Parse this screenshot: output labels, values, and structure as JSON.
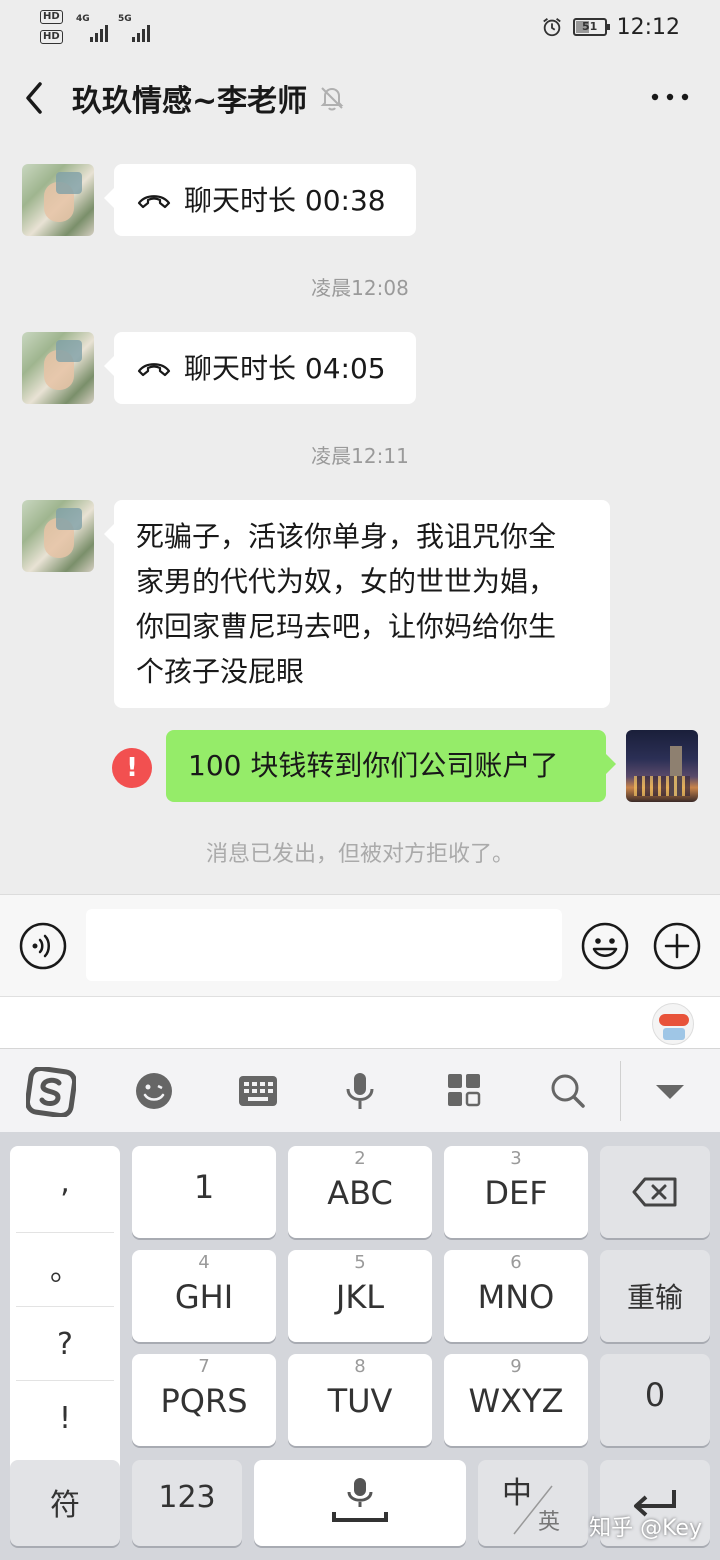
{
  "status_bar": {
    "hd1": "HD",
    "hd2": "HD",
    "net1": "4G",
    "net2": "5G",
    "battery": "51",
    "time": "12:12"
  },
  "header": {
    "title": "玖玖情感~李老师"
  },
  "messages": {
    "call1": "聊天时长 00:38",
    "ts1": "凌晨12:08",
    "call2": "聊天时长 04:05",
    "ts2": "凌晨12:11",
    "text_line1": "死骗子，活该你单身，我诅咒你全",
    "text_line2": "家男的代代为奴，女的世世为娼，",
    "text_line3": "你回家曹尼玛去吧，让你妈给你生",
    "text_line4": "个孩子没屁眼",
    "sent": "100 块钱转到你们公司账户了",
    "error_mark": "!",
    "rejected_notice": "消息已发出，但被对方拒收了。"
  },
  "keyboard": {
    "punct": [
      ",",
      "。",
      "?",
      "!"
    ],
    "k1": "1",
    "k2_num": "2",
    "k2": "ABC",
    "k3_num": "3",
    "k3": "DEF",
    "k4_num": "4",
    "k4": "GHI",
    "k5_num": "5",
    "k5": "JKL",
    "k6_num": "6",
    "k6": "MNO",
    "k7_num": "7",
    "k7": "PQRS",
    "k8_num": "8",
    "k8": "TUV",
    "k9_num": "9",
    "k9": "WXYZ",
    "k0": "0",
    "retype": "重输",
    "symbols": "符",
    "numbers": "123",
    "lang_main": "中",
    "lang_alt": "英"
  },
  "watermark": "知乎 @Key",
  "colors": {
    "sent_bubble": "#95ec69",
    "received_bubble": "#ffffff",
    "error": "#f25050",
    "chat_bg": "#ededed"
  }
}
